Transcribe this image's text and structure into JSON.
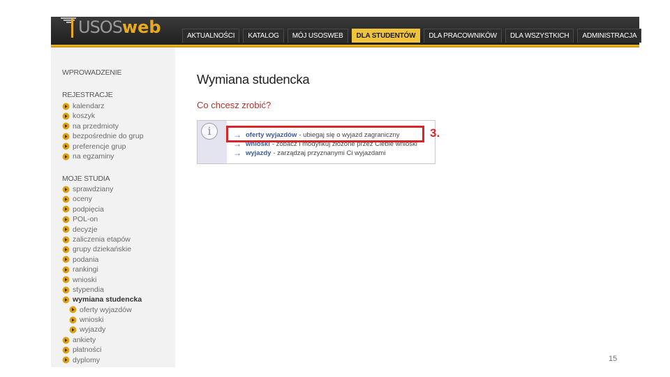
{
  "brand": {
    "usos": "USOS",
    "web": "web",
    "colors": {
      "gold": "#f0c33c",
      "header_dark": "#2a2a2a"
    }
  },
  "nav": {
    "tabs": [
      {
        "label": "AKTUALNOŚCI",
        "active": false
      },
      {
        "label": "KATALOG",
        "active": false
      },
      {
        "label": "MÓJ USOSWEB",
        "active": false
      },
      {
        "label": "DLA STUDENTÓW",
        "active": true
      },
      {
        "label": "DLA PRACOWNIKÓW",
        "active": false
      },
      {
        "label": "DLA WSZYSTKICH",
        "active": false
      },
      {
        "label": "ADMINISTRACJA",
        "active": false
      }
    ]
  },
  "sidebar": {
    "intro": "WPROWADZENIE",
    "registration_header": "REJESTRACJE",
    "registration_items": [
      "kalendarz",
      "koszyk",
      "na przedmioty",
      "bezpośrednie do grup",
      "preferencje grup",
      "na egzaminy"
    ],
    "studies_header": "MOJE STUDIA",
    "studies_items": [
      {
        "label": "sprawdziany"
      },
      {
        "label": "oceny"
      },
      {
        "label": "podpięcia"
      },
      {
        "label": "POL-on"
      },
      {
        "label": "decyzje"
      },
      {
        "label": "zaliczenia etapów"
      },
      {
        "label": "grupy dziekańskie"
      },
      {
        "label": "podania"
      },
      {
        "label": "rankingi"
      },
      {
        "label": "wnioski"
      },
      {
        "label": "stypendia"
      },
      {
        "label": "wymiana studencka",
        "current": true
      },
      {
        "label": "oferty wyjazdów",
        "sub": true
      },
      {
        "label": "wnioski",
        "sub": true
      },
      {
        "label": "wyjazdy",
        "sub": true
      },
      {
        "label": "ankiety"
      },
      {
        "label": "płatności"
      },
      {
        "label": "dyplomy"
      }
    ]
  },
  "main": {
    "title": "Wymiana studencka",
    "question": "Co chcesz zrobić?",
    "info_icon": "info-icon",
    "options": [
      {
        "link": "oferty wyjazdów",
        "desc": "- ubiegaj się o wyjazd zagraniczny"
      },
      {
        "link": "wnioski",
        "desc": "- zobacz i modyfikuj złożone przez Ciebie wnioski"
      },
      {
        "link": "wyjazdy",
        "desc": "- zarządzaj przyznanymi Ci wyjazdami"
      }
    ]
  },
  "annotation": {
    "step_label": "3.",
    "color": "#d9262a"
  },
  "slide": {
    "page_number": "15"
  }
}
